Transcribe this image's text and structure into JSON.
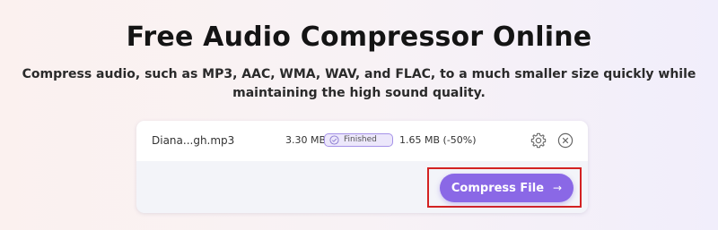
{
  "page": {
    "title": "Free Audio Compressor Online",
    "subtitle": "Compress audio, such as MP3, AAC, WMA, WAV, and FLAC, to a much smaller size quickly while maintaining the high sound quality."
  },
  "file": {
    "name": "Diana...gh.mp3",
    "original_size": "3.30 MB",
    "status": "Finished",
    "compressed_size": "1.65 MB (-50%)"
  },
  "actions": {
    "compress_label": "Compress File",
    "compress_arrow": "→"
  },
  "icons": {
    "settings": "gear-icon",
    "remove": "close-circle-icon",
    "status": "check-circle-icon"
  },
  "colors": {
    "accent": "#8a68e6",
    "highlight": "#d32222",
    "badge_border": "#a592e8"
  }
}
